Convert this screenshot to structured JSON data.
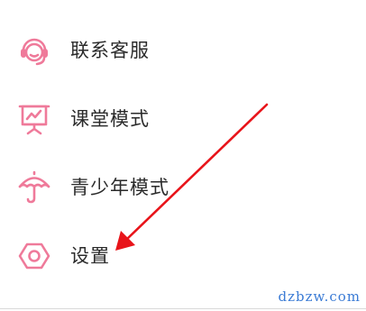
{
  "menu": {
    "items": [
      {
        "label": "联系客服",
        "icon": "headset-icon"
      },
      {
        "label": "课堂模式",
        "icon": "presentation-board-icon"
      },
      {
        "label": "青少年模式",
        "icon": "umbrella-icon"
      },
      {
        "label": "设置",
        "icon": "hexagon-settings-icon"
      }
    ]
  },
  "colors": {
    "icon_accent": "#ef7a9a",
    "arrow": "#e8141a",
    "label_text": "#2a2a2a",
    "watermark": "#3a7bd5"
  },
  "watermark": {
    "text": "dzbzw.com"
  }
}
